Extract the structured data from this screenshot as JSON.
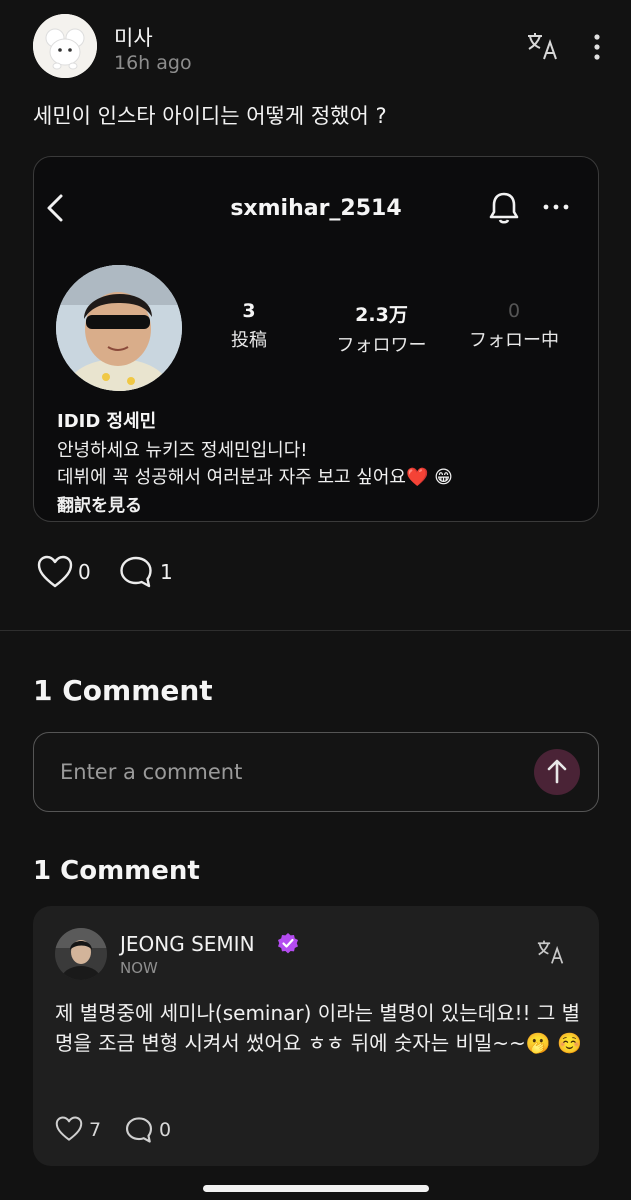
{
  "post": {
    "author": "미사",
    "time": "16h ago",
    "text": "세민이 인스타 아이디는 어떻게 정했어 ?"
  },
  "embed": {
    "username": "sxmihar_2514",
    "stats": [
      {
        "value": "3",
        "label": "投稿"
      },
      {
        "value": "2.3万",
        "label": "フォロワー"
      },
      {
        "value": "0",
        "label": "フォロー中"
      }
    ],
    "name": "IDID 정세민",
    "bio_line1": "안녕하세요 뉴키즈 정세민입니다!",
    "bio_line2": "데뷔에 꼭 성공해서 여러분과 자주 보고 싶어요❤️ 😁",
    "see_translation": "翻訳を見る"
  },
  "reactions": {
    "likes": "0",
    "comments": "1"
  },
  "comments_section": {
    "title_top": "1 Comment",
    "input_placeholder": "Enter a comment",
    "title_list": "1 Comment"
  },
  "comment": {
    "author": "JEONG SEMIN",
    "time": "NOW",
    "text": "제 별명중에 세미나(seminar) 이라는 별명이 있는데요!! 그 별명을 조금 변형 시켜서 썼어요 ㅎㅎ 뒤에 숫자는 비밀~~🫢 ☺️",
    "likes": "7",
    "replies": "0"
  },
  "colors": {
    "background": "#121212",
    "card": "#1f1f1f",
    "send_button": "#4a2336",
    "verified": "#b44cf0"
  }
}
